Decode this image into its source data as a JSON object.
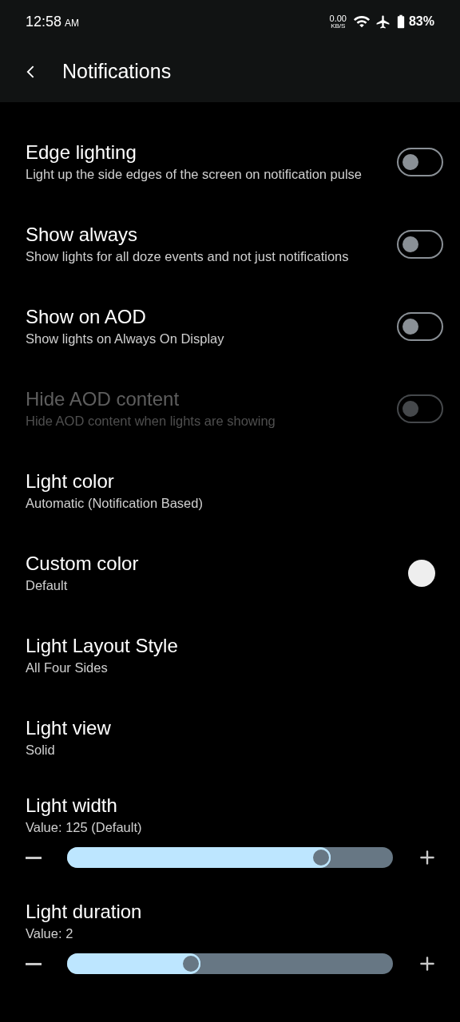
{
  "status_bar": {
    "time": "12:58",
    "ampm": "AM",
    "net_speed": "0.00",
    "net_unit": "KB/S",
    "battery": "83%"
  },
  "app_bar": {
    "title": "Notifications"
  },
  "items": [
    {
      "kind": "toggle",
      "title": "Edge lighting",
      "subtitle": "Light up the side edges of the screen on notification pulse",
      "on": false,
      "disabled": false
    },
    {
      "kind": "toggle",
      "title": "Show always",
      "subtitle": "Show lights for all doze events and not just notifications",
      "on": false,
      "disabled": false
    },
    {
      "kind": "toggle",
      "title": "Show on AOD",
      "subtitle": "Show lights on Always On Display",
      "on": false,
      "disabled": false
    },
    {
      "kind": "toggle",
      "title": "Hide AOD content",
      "subtitle": "Hide AOD content when lights are showing",
      "on": false,
      "disabled": true
    },
    {
      "kind": "plain",
      "title": "Light color",
      "subtitle": "Automatic (Notification Based)",
      "disabled": false
    },
    {
      "kind": "color",
      "title": "Custom color",
      "subtitle": "Default",
      "color": "#eeeeee",
      "disabled": false
    },
    {
      "kind": "plain",
      "title": "Light Layout Style",
      "subtitle": "All Four Sides",
      "disabled": false
    },
    {
      "kind": "plain",
      "title": "Light view",
      "subtitle": "Solid",
      "disabled": false
    },
    {
      "kind": "slider",
      "title": "Light width",
      "subtitle": "Value: 125 (Default)",
      "level": 0.81,
      "disabled": false
    },
    {
      "kind": "slider",
      "title": "Light duration",
      "subtitle": "Value: 2",
      "level": 0.41,
      "disabled": false
    }
  ]
}
